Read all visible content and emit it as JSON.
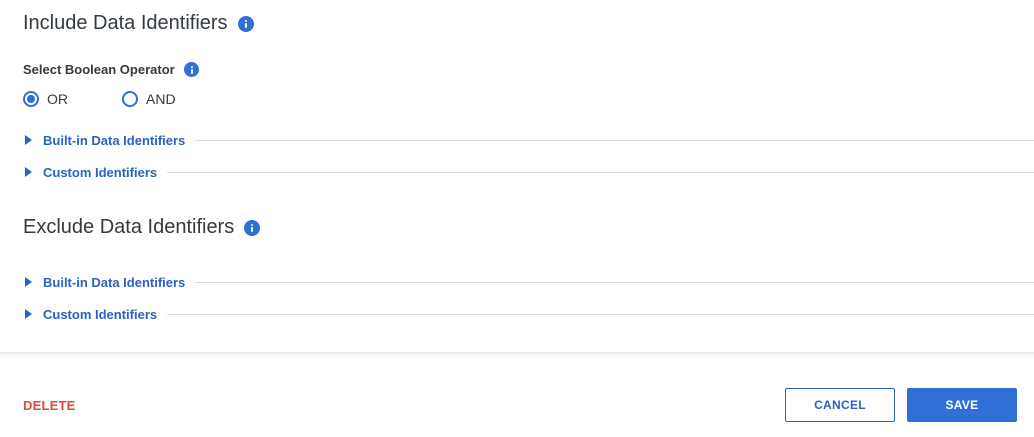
{
  "include": {
    "title": "Include Data Identifiers",
    "operator_label": "Select Boolean Operator",
    "operators": [
      {
        "label": "OR",
        "checked": true
      },
      {
        "label": "AND",
        "checked": false
      }
    ],
    "builtin_label": "Built-in Data Identifiers",
    "custom_label": "Custom Identifiers"
  },
  "exclude": {
    "title": "Exclude Data Identifiers",
    "builtin_label": "Built-in Data Identifiers",
    "custom_label": "Custom Identifiers"
  },
  "footer": {
    "delete_label": "DELETE",
    "cancel_label": "CANCEL",
    "save_label": "SAVE"
  },
  "colors": {
    "accent": "#2f6fd6",
    "link": "#2a63c4",
    "danger": "#e04a3b"
  }
}
